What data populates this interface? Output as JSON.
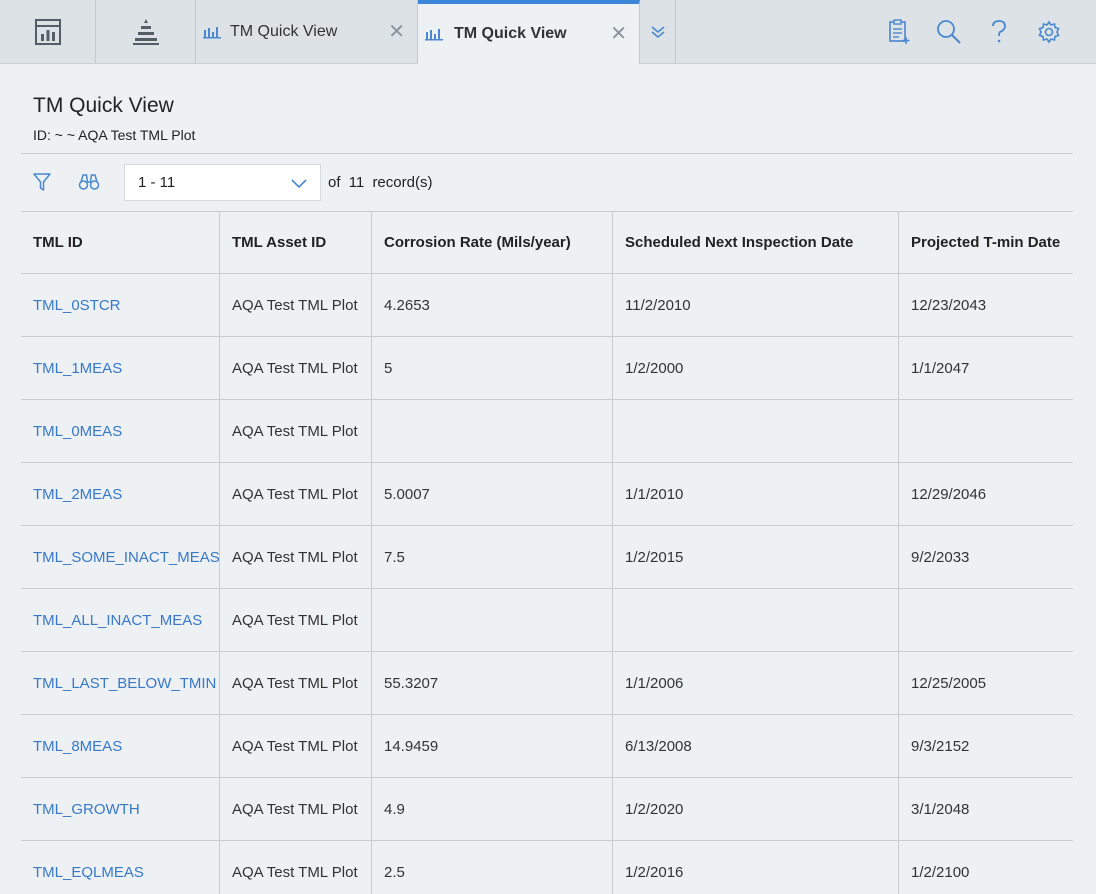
{
  "tabs": [
    {
      "label": "TM Quick View",
      "active": false
    },
    {
      "label": "TM Quick View",
      "active": true
    }
  ],
  "icons": {
    "home": "dashboard-icon",
    "tree": "asset-hierarchy-icon",
    "tab": "chart-icon",
    "close": "close-icon",
    "overflow": "chevron-double-down-icon",
    "queue": "clipboard-add-icon",
    "search": "search-icon",
    "help": "help-icon",
    "settings": "gear-icon",
    "filter": "filter-icon",
    "find": "binoculars-icon",
    "dropdown": "chevron-down-icon"
  },
  "colors": {
    "accent": "#3b86d8",
    "link": "#3778c7",
    "icon": "#4a88cf"
  },
  "page": {
    "title": "TM Quick View",
    "subtitle": "ID: ~ ~ AQA Test TML Plot"
  },
  "toolbar": {
    "range": "1 - 11",
    "of_label": "of",
    "total": "11",
    "records_label": "record(s)"
  },
  "table": {
    "columns": [
      "TML ID",
      "TML Asset ID",
      "Corrosion Rate (Mils/year)",
      "Scheduled Next Inspection Date",
      "Projected T-min Date"
    ],
    "rows": [
      [
        "TML_0STCR",
        "AQA Test TML Plot",
        "4.2653",
        "11/2/2010",
        "12/23/2043"
      ],
      [
        "TML_1MEAS",
        "AQA Test TML Plot",
        "5",
        "1/2/2000",
        "1/1/2047"
      ],
      [
        "TML_0MEAS",
        "AQA Test TML Plot",
        "",
        "",
        ""
      ],
      [
        "TML_2MEAS",
        "AQA Test TML Plot",
        "5.0007",
        "1/1/2010",
        "12/29/2046"
      ],
      [
        "TML_SOME_INACT_MEAS",
        "AQA Test TML Plot",
        "7.5",
        "1/2/2015",
        "9/2/2033"
      ],
      [
        "TML_ALL_INACT_MEAS",
        "AQA Test TML Plot",
        "",
        "",
        ""
      ],
      [
        "TML_LAST_BELOW_TMIN",
        "AQA Test TML Plot",
        "55.3207",
        "1/1/2006",
        "12/25/2005"
      ],
      [
        "TML_8MEAS",
        "AQA Test TML Plot",
        "14.9459",
        "6/13/2008",
        "9/3/2152"
      ],
      [
        "TML_GROWTH",
        "AQA Test TML Plot",
        "4.9",
        "1/2/2020",
        "3/1/2048"
      ],
      [
        "TML_EQLMEAS",
        "AQA Test TML Plot",
        "2.5",
        "1/2/2016",
        "1/2/2100"
      ]
    ]
  }
}
